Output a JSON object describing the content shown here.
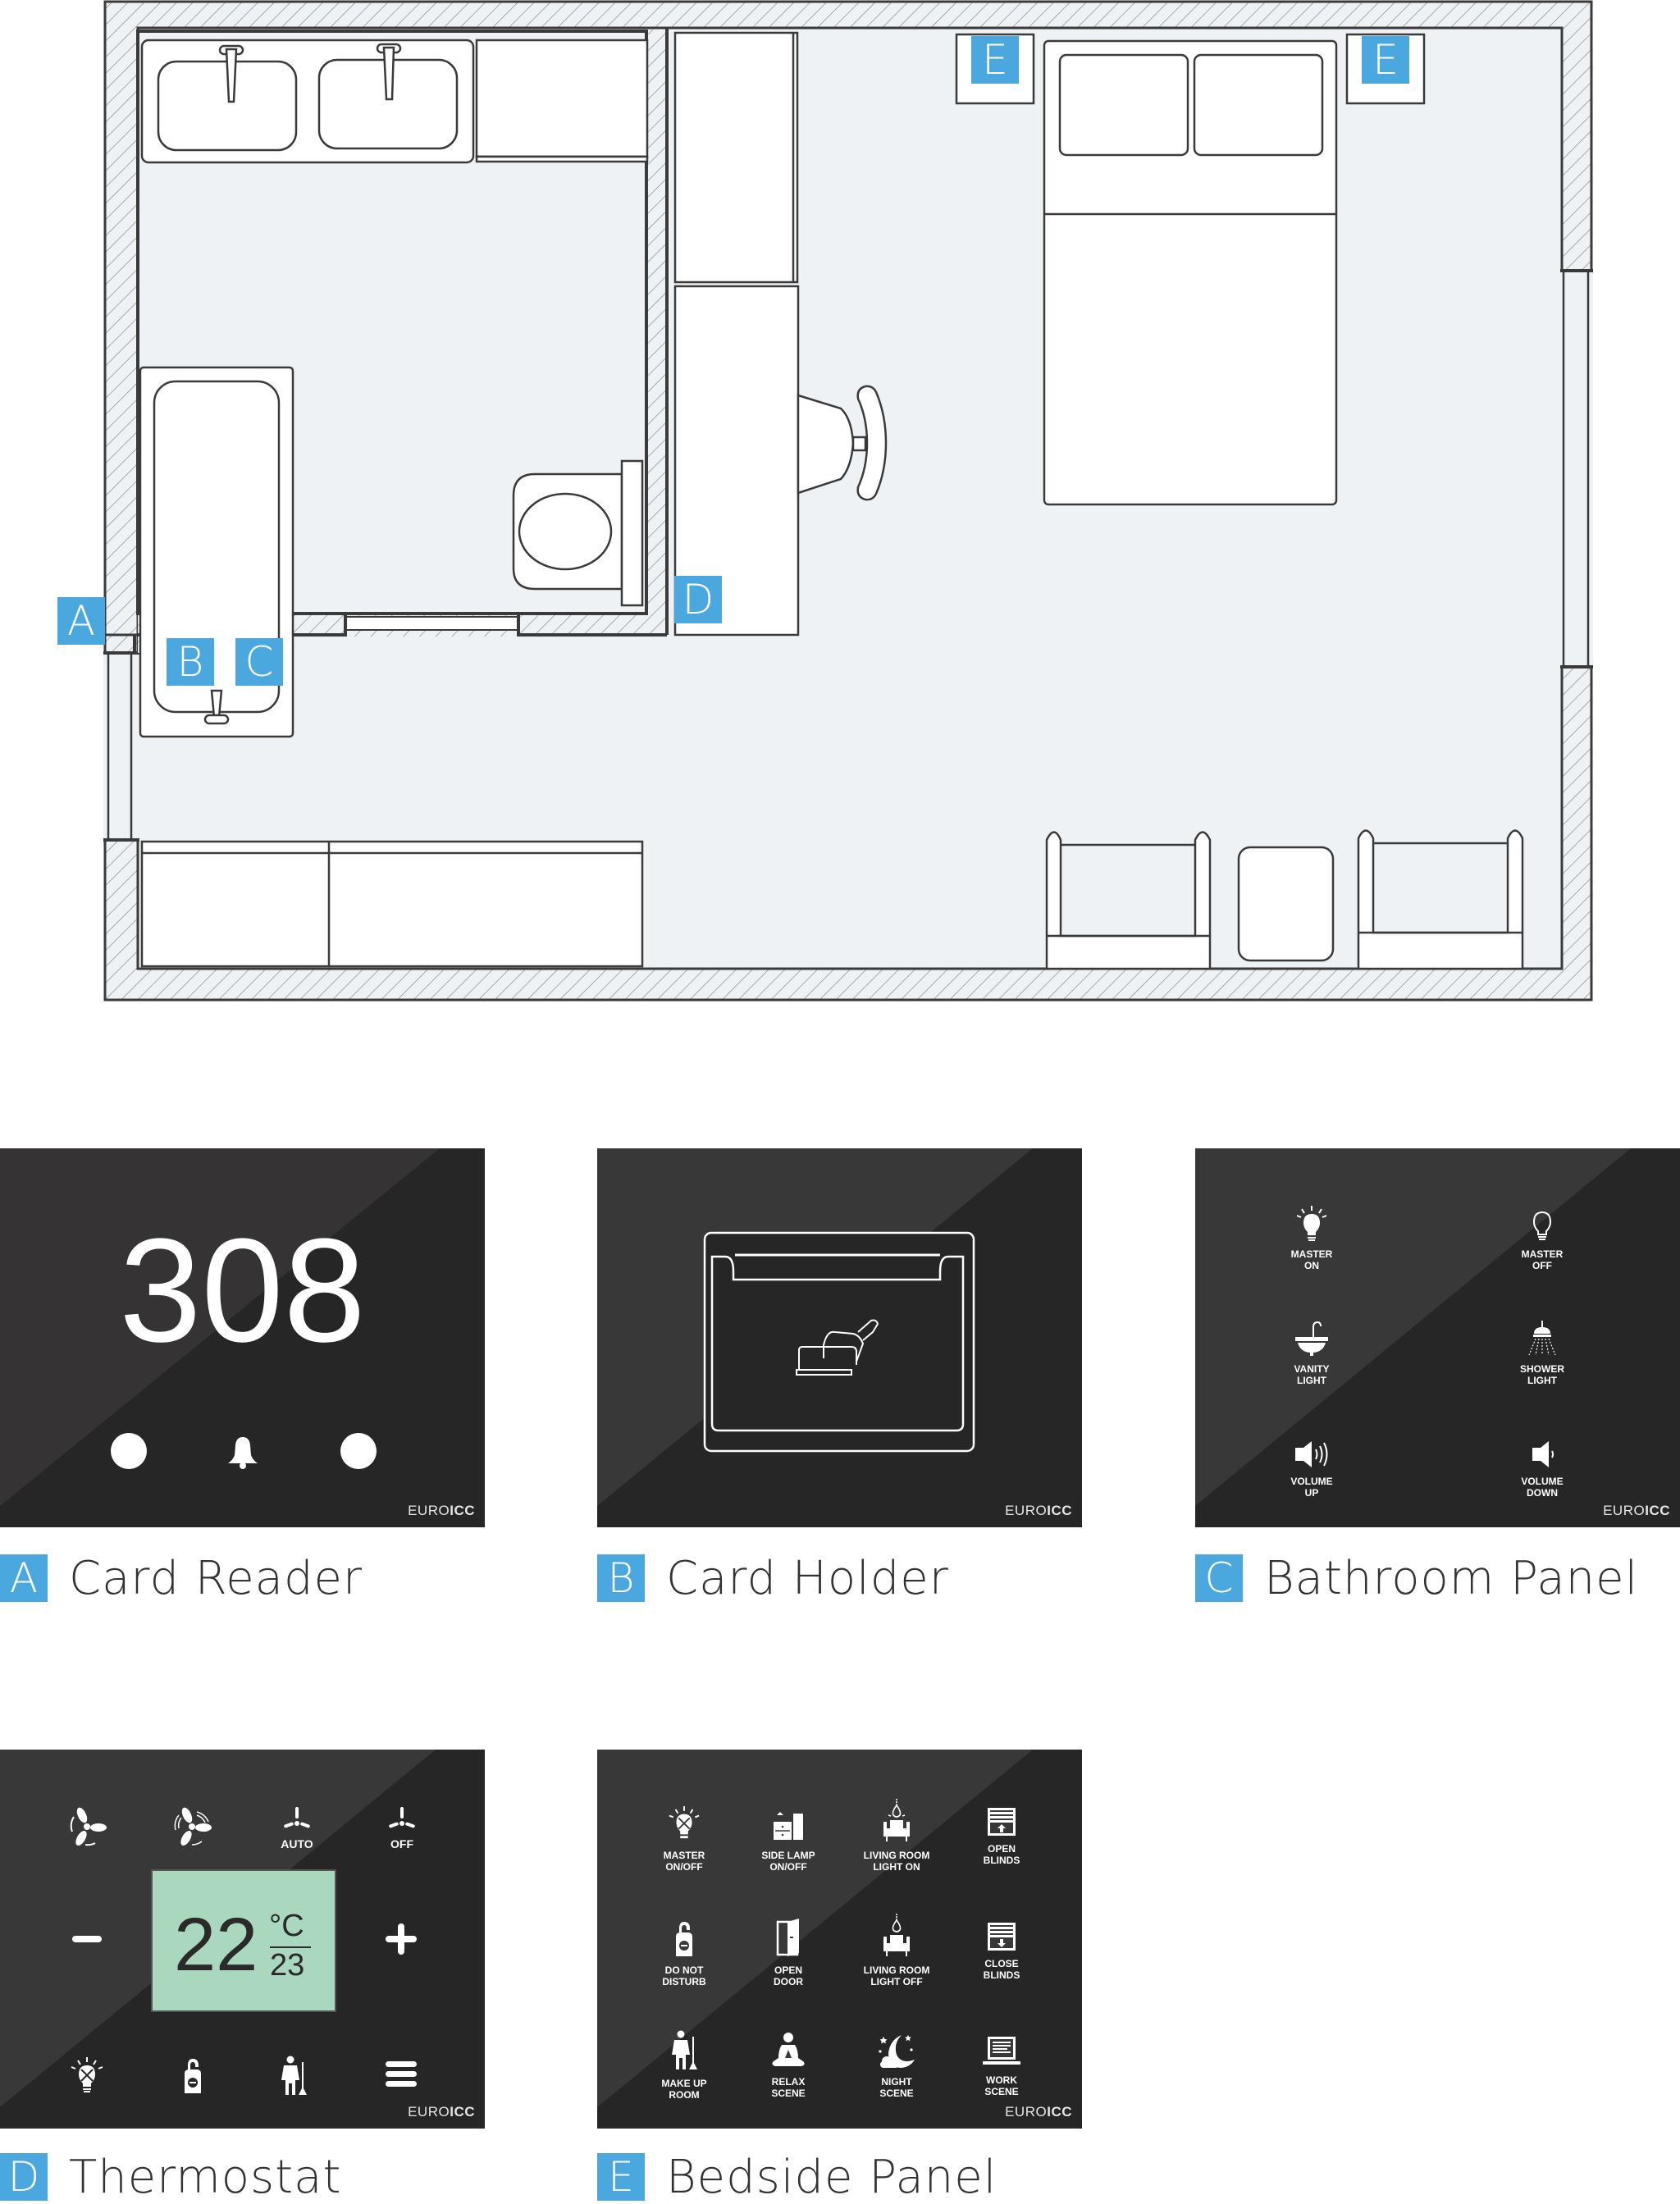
{
  "colors": {
    "accent": "#4aa8df",
    "panel_bg": "#262626",
    "floor": "#eef2f5",
    "wall_line": "#3a3a3a",
    "lcd": "#aad8be"
  },
  "floorplan": {
    "markers": {
      "a": "A",
      "b": "B",
      "c": "C",
      "d": "D",
      "e1": "E",
      "e2": "E"
    }
  },
  "brand": {
    "prefix": "EURO",
    "suffix": "ICC"
  },
  "panels": {
    "card_reader": {
      "letter": "A",
      "title": "Card Reader",
      "room_number": "308",
      "icons": [
        "indicator-dot",
        "bell",
        "indicator-dot"
      ]
    },
    "card_holder": {
      "letter": "B",
      "title": "Card Holder",
      "icon": "card-insert"
    },
    "bathroom": {
      "letter": "C",
      "title": "Bathroom Panel",
      "buttons": [
        {
          "l1": "MASTER",
          "l2": "ON",
          "icon": "bulb-on"
        },
        {
          "l1": "MASTER",
          "l2": "OFF",
          "icon": "bulb-off"
        },
        {
          "l1": "VANITY",
          "l2": "LIGHT",
          "icon": "sink"
        },
        {
          "l1": "SHOWER",
          "l2": "LIGHT",
          "icon": "shower"
        },
        {
          "l1": "VOLUME",
          "l2": "UP",
          "icon": "volume-up"
        },
        {
          "l1": "VOLUME",
          "l2": "DOWN",
          "icon": "volume-down"
        }
      ]
    },
    "thermostat": {
      "letter": "D",
      "title": "Thermostat",
      "current_temp": "22",
      "unit": "°C",
      "setpoint": "23",
      "fan_labels": {
        "auto": "AUTO",
        "off": "OFF"
      },
      "minus": "−",
      "plus": "+",
      "icons": [
        "fan-low",
        "fan-high",
        "fan-auto",
        "fan-off",
        "minus",
        "plus",
        "master-light",
        "do-not-disturb",
        "make-up-room",
        "menu"
      ]
    },
    "bedside": {
      "letter": "E",
      "title": "Bedside Panel",
      "buttons": [
        {
          "l1": "MASTER",
          "l2": "ON/OFF",
          "icon": "bulb-x"
        },
        {
          "l1": "SIDE LAMP",
          "l2": "ON/OFF",
          "icon": "side-lamp"
        },
        {
          "l1": "LIVING ROOM",
          "l2": "LIGHT ON",
          "icon": "armchair-light-on"
        },
        {
          "l1": "OPEN",
          "l2": "BLINDS",
          "icon": "blinds-open"
        },
        {
          "l1": "DO NOT",
          "l2": "DISTURB",
          "icon": "door-hanger"
        },
        {
          "l1": "OPEN",
          "l2": "DOOR",
          "icon": "door-open"
        },
        {
          "l1": "LIVING ROOM",
          "l2": "LIGHT OFF",
          "icon": "armchair-light-off"
        },
        {
          "l1": "CLOSE",
          "l2": "BLINDS",
          "icon": "blinds-close"
        },
        {
          "l1": "MAKE UP",
          "l2": "ROOM",
          "icon": "maid"
        },
        {
          "l1": "RELAX",
          "l2": "SCENE",
          "icon": "meditation"
        },
        {
          "l1": "NIGHT",
          "l2": "SCENE",
          "icon": "moon"
        },
        {
          "l1": "WORK",
          "l2": "SCENE",
          "icon": "laptop"
        }
      ]
    }
  }
}
